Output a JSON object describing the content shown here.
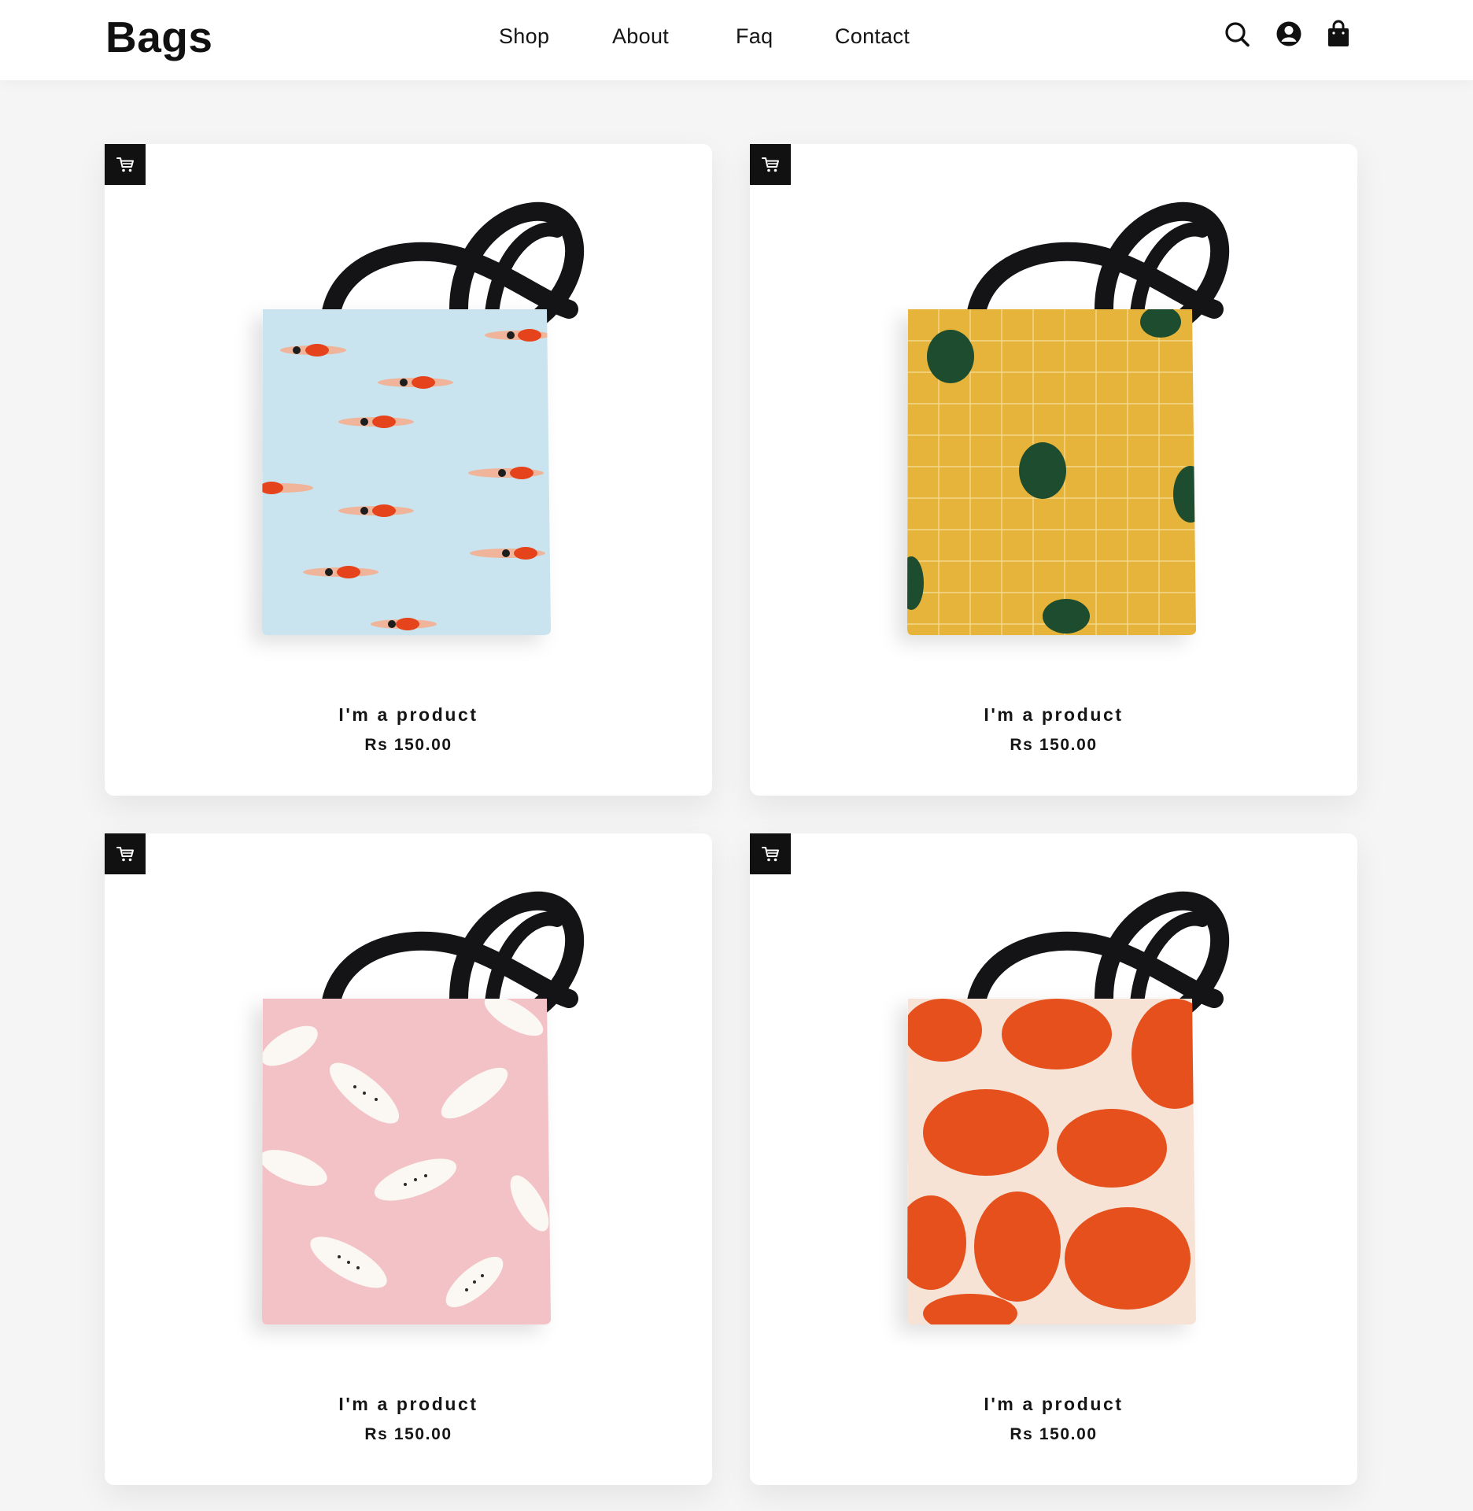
{
  "header": {
    "logo": "Bags",
    "nav": [
      "Shop",
      "About",
      "Faq",
      "Contact"
    ],
    "icons": [
      "search-icon",
      "account-icon",
      "shopping-bag-icon"
    ]
  },
  "products": [
    {
      "name": "I'm a product",
      "price": "Rs 150.00",
      "pattern": "swimmers",
      "color": "#c9e4ee"
    },
    {
      "name": "I'm a product",
      "price": "Rs 150.00",
      "pattern": "monstera-grid",
      "color": "#e7b43a"
    },
    {
      "name": "I'm a product",
      "price": "Rs 150.00",
      "pattern": "leopards",
      "color": "#f3c2c6"
    },
    {
      "name": "I'm a product",
      "price": "Rs 150.00",
      "pattern": "orange-brush",
      "color": "#e5501c"
    }
  ],
  "colors": {
    "accent": "#111111",
    "page_bg": "#f5f5f6",
    "card_bg": "#ffffff"
  }
}
